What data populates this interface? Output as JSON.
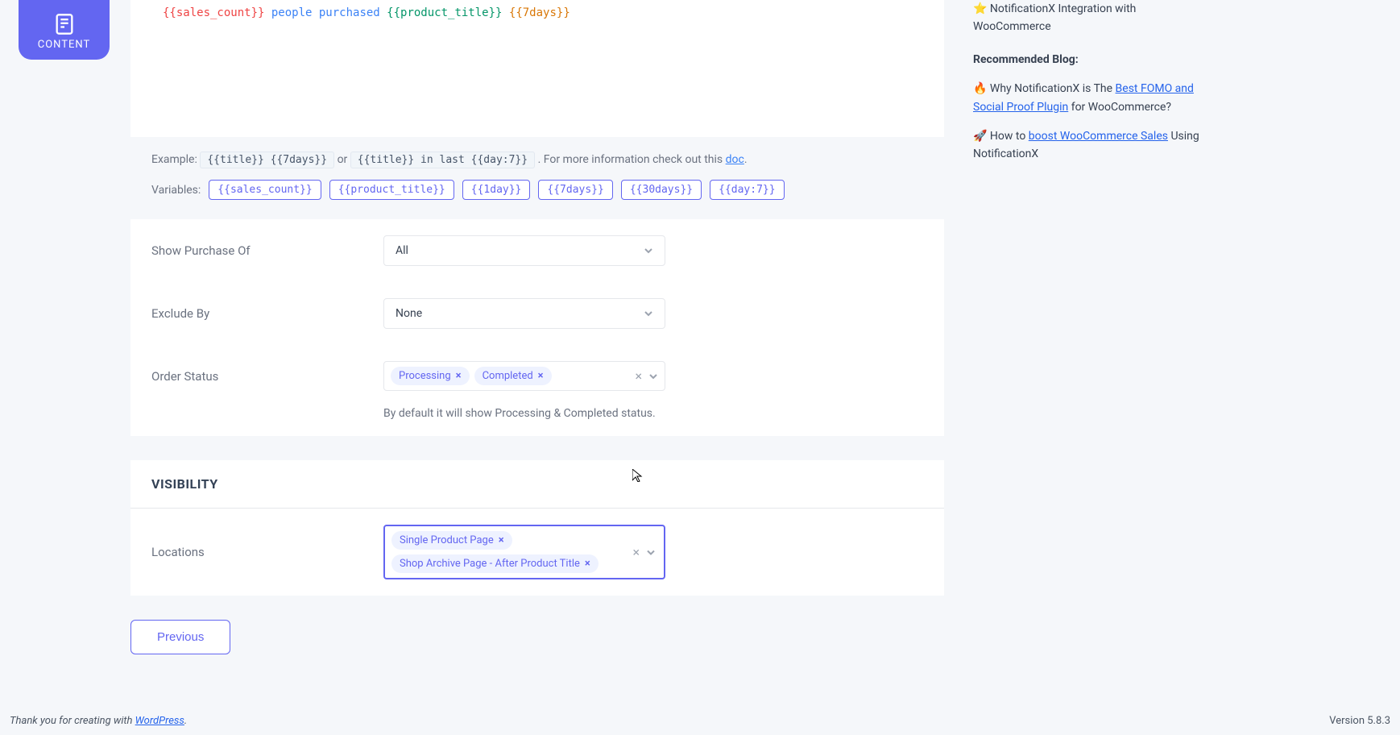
{
  "tab": {
    "label": "CONTENT"
  },
  "template": {
    "sales_token": "{{sales_count}}",
    "text": " people purchased ",
    "product_token": "{{product_title}}",
    "days_token": "{{7days}}"
  },
  "example": {
    "label": "Example: ",
    "code1": "{{title}} {{7days}}",
    "or": " or ",
    "code2": "{{title}} in last {{day:7}}",
    "desc": " . For more information check out this ",
    "doc": "doc"
  },
  "variables": {
    "label": "Variables:",
    "items": [
      "{{sales_count}}",
      "{{product_title}}",
      "{{1day}}",
      "{{7days}}",
      "{{30days}}",
      "{{day:7}}"
    ]
  },
  "fields": {
    "show_purchase": {
      "label": "Show Purchase Of",
      "value": "All"
    },
    "exclude_by": {
      "label": "Exclude By",
      "value": "None"
    },
    "order_status": {
      "label": "Order Status",
      "tags": [
        "Processing",
        "Completed"
      ],
      "help": "By default it will show Processing & Completed status."
    },
    "locations": {
      "label": "Locations",
      "tags": [
        "Single Product Page",
        "Shop Archive Page - After Product Title"
      ]
    }
  },
  "sections": {
    "visibility": "VISIBILITY"
  },
  "buttons": {
    "previous": "Previous"
  },
  "sidebar": {
    "item1_icon": "⭐",
    "item1": " NotificationX Integration with WooCommerce",
    "heading": "Recommended Blog:",
    "item2_icon": "🔥",
    "item2_pre": " Why NotificationX is The ",
    "item2_link": "Best FOMO and Social Proof Plugin",
    "item2_post": " for WooCommerce?",
    "item3_icon": "🚀",
    "item3_pre": " How to ",
    "item3_link": "boost WooCommerce Sales",
    "item3_post": " Using NotificationX"
  },
  "footer": {
    "thanks_pre": "Thank you for creating with ",
    "wp": "WordPress",
    "thanks_post": ".",
    "version": "Version 5.8.3"
  }
}
